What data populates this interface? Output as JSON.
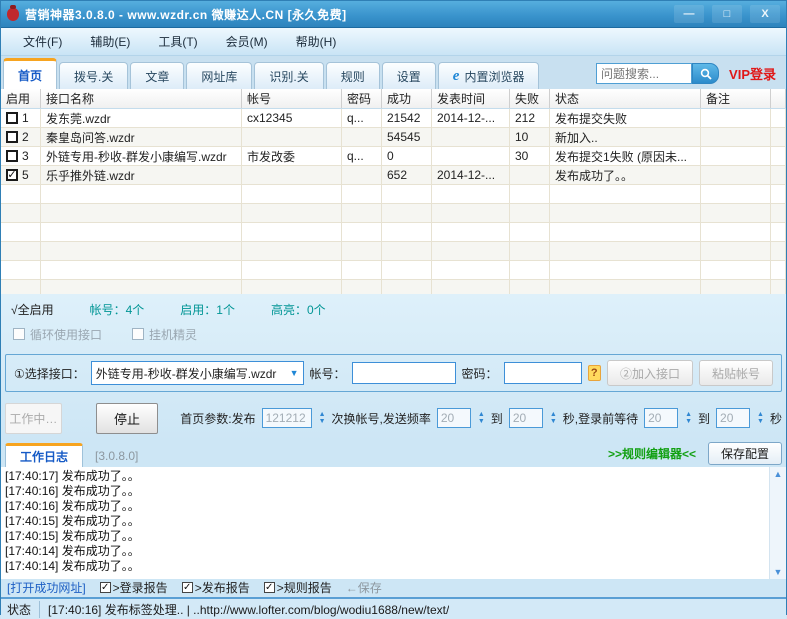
{
  "window": {
    "title": "营销神器3.0.8.0 - www.wzdr.cn 微赚达人.CN [永久免费]",
    "minimize_glyph": "—",
    "maximize_glyph": "□",
    "close_glyph": "X"
  },
  "menubar": {
    "items": [
      {
        "label": "文件(F)"
      },
      {
        "label": "辅助(E)"
      },
      {
        "label": "工具(T)"
      },
      {
        "label": "会员(M)"
      },
      {
        "label": "帮助(H)"
      }
    ]
  },
  "tabbar": {
    "tabs": [
      {
        "label": "首页"
      },
      {
        "label": "拨号.关"
      },
      {
        "label": "文章"
      },
      {
        "label": "网址库"
      },
      {
        "label": "识别.关"
      },
      {
        "label": "规则"
      },
      {
        "label": "设置"
      },
      {
        "label": "内置浏览器"
      }
    ],
    "ie_glyph": "e",
    "search_placeholder": "问题搜索...",
    "vip_label": "VIP登录"
  },
  "table": {
    "columns": [
      "启用",
      "接口名称",
      "帐号",
      "密码",
      "成功",
      "发表时间",
      "失败",
      "状态",
      "备注"
    ],
    "rows": [
      {
        "check": "",
        "num": "1",
        "name": "发东莞.wzdr",
        "account": "cx12345",
        "password": "q...",
        "success": "21542",
        "time": "2014-12-...",
        "fail": "212",
        "status": "发布提交失败",
        "note": ""
      },
      {
        "check": "",
        "num": "2",
        "name": "秦皇岛问答.wzdr",
        "account": "",
        "password": "",
        "success": "54545",
        "time": "",
        "fail": "10",
        "status": "新加入..",
        "note": ""
      },
      {
        "check": "",
        "num": "3",
        "name": "外链专用-秒收-群发小康编写.wzdr",
        "account": "市发改委",
        "password": "q...",
        "success": "0",
        "time": "",
        "fail": "30",
        "status": "发布提交1失败 (原因未...",
        "note": ""
      },
      {
        "check": "✓",
        "num": "5",
        "name": "乐乎推外链.wzdr",
        "account": "",
        "password": "",
        "success": "652",
        "time": "2014-12-...",
        "fail": "",
        "status": "发布成功了。。",
        "note": ""
      }
    ]
  },
  "summary": {
    "select_all": "√全启用",
    "accounts": "帐号：4个",
    "enabled": "启用：1个",
    "highlight": "高亮：0个"
  },
  "options": {
    "loop_label": "循环使用接口",
    "hangup_label": "挂机精灵"
  },
  "interface_panel": {
    "select_label": "①选择接口：",
    "selected_interface": "外链专用-秒收-群发小康编写.wzdr",
    "dropdown_arrow": "▼",
    "account_label": "帐号：",
    "password_label": "密码：",
    "help_glyph": "?",
    "add_button": "②加入接口",
    "paste_button": "粘贴帐号"
  },
  "controls": {
    "working_button": "工作中…",
    "stop_button": "停止",
    "param_label": "首页参数:发布",
    "publish_value": "121212",
    "freq_label": "次换帐号,发送频率",
    "freq_from": "20",
    "to_label_1": "到",
    "freq_to": "20",
    "wait_label": "秒,登录前等待",
    "wait_from": "20",
    "to_label_2": "到",
    "wait_to": "20",
    "sec_label": "秒",
    "up_glyph": "▲",
    "down_glyph": "▼"
  },
  "log_panel": {
    "tab_label": "工作日志",
    "version": "[3.0.8.0]",
    "rule_editor": ">>规则编辑器<<",
    "save_config": "保存配置",
    "entries": [
      {
        "text": "[17:40:17] 发布成功了。。"
      },
      {
        "text": "[17:40:16] 发布成功了。。"
      },
      {
        "text": "[17:40:16] 发布成功了。。"
      },
      {
        "text": "[17:40:15] 发布成功了。。"
      },
      {
        "text": "[17:40:15] 发布成功了。。"
      },
      {
        "text": "[17:40:14] 发布成功了。。"
      },
      {
        "text": "[17:40:14] 发布成功了。。"
      }
    ],
    "scroll_up_glyph": "▲",
    "scroll_down_glyph": "▼",
    "open_urls": "[打开成功网址]",
    "reports": [
      {
        "check": "✓",
        "label": ">登录报告"
      },
      {
        "check": "✓",
        "label": ">发布报告"
      },
      {
        "check": "✓",
        "label": ">规则报告"
      }
    ],
    "save_hint": "←保存"
  },
  "statusbar": {
    "label": "状态",
    "message": "[17:40:16] 发布标签处理.. | ..http://www.lofter.com/blog/wodiu1688/new/text/"
  },
  "colors": {
    "titlebar_blue": "#3a94cd",
    "accent_orange": "#f7a420",
    "active_tab_blue": "#155ac6",
    "teal_stats": "#009595",
    "green_rule_editor": "#12a012",
    "vip_red": "#e01818"
  }
}
